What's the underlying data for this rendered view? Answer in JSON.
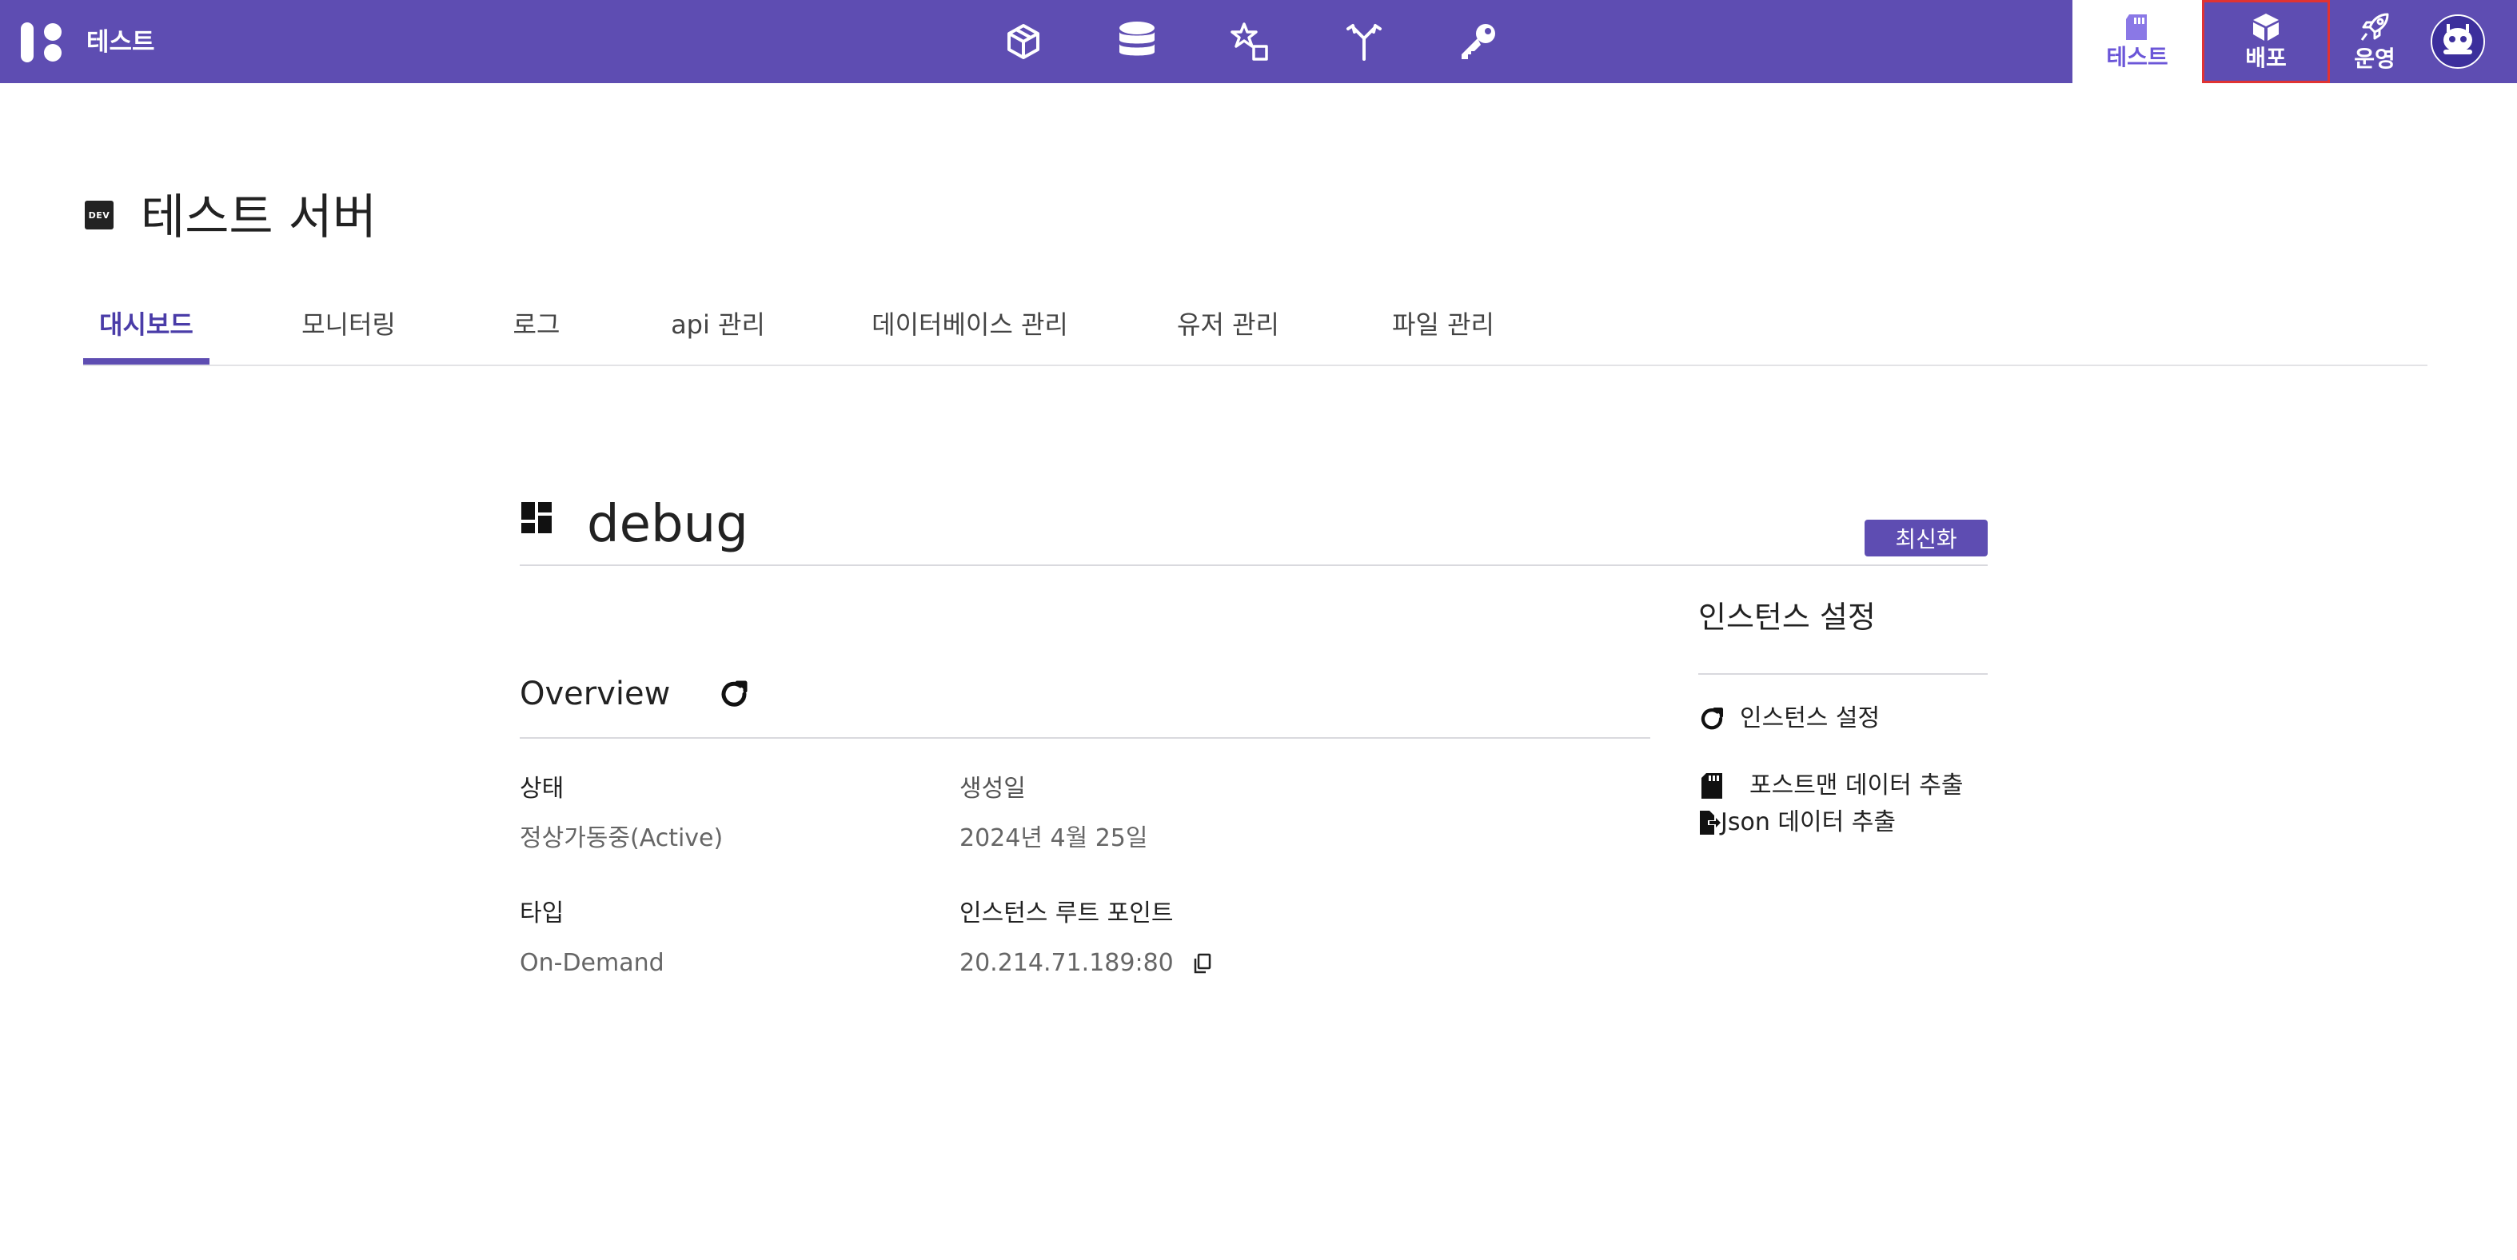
{
  "header": {
    "app_title": "테스트",
    "center_icons": [
      "cube-outline-icon",
      "database-icon",
      "shapes-icon",
      "merge-arrows-icon",
      "key-icon"
    ],
    "right_nav": [
      {
        "label": "테스트",
        "icon": "sd-card-icon",
        "active": true
      },
      {
        "label": "배포",
        "icon": "box-icon",
        "active": false,
        "highlighted": true
      },
      {
        "label": "운영",
        "icon": "rocket-icon",
        "active": false
      }
    ],
    "avatar": "user-avatar",
    "accent_color": "#5e4db2"
  },
  "page": {
    "badge": "DEV",
    "title": "테스트 서버"
  },
  "tabs": [
    {
      "label": "대시보드",
      "active": true
    },
    {
      "label": "모니터링"
    },
    {
      "label": "로그"
    },
    {
      "label": "api 관리"
    },
    {
      "label": "데이터베이스 관리"
    },
    {
      "label": "유저 관리"
    },
    {
      "label": "파일 관리"
    }
  ],
  "dashboard": {
    "title": "debug",
    "refresh_label": "최신화",
    "overview": {
      "title": "Overview",
      "fields": {
        "status": {
          "label": "상태",
          "value": "정상가동중(Active)"
        },
        "created": {
          "label": "생성일",
          "value": "2024년 4월 25일"
        },
        "type": {
          "label": "타입",
          "value": "On-Demand"
        },
        "endpoint": {
          "label": "인스턴스 루트 포인트",
          "value": "20.214.71.189:80"
        }
      }
    },
    "instance_settings": {
      "title": "인스턴스 설정",
      "items": [
        {
          "label": "인스턴스 설정",
          "icon": "refresh-icon"
        },
        {
          "label": "포스트맨 데이터 추출",
          "icon": "sd-card-icon"
        },
        {
          "label": "Json 데이터 추출",
          "icon": "file-export-icon"
        }
      ]
    }
  }
}
